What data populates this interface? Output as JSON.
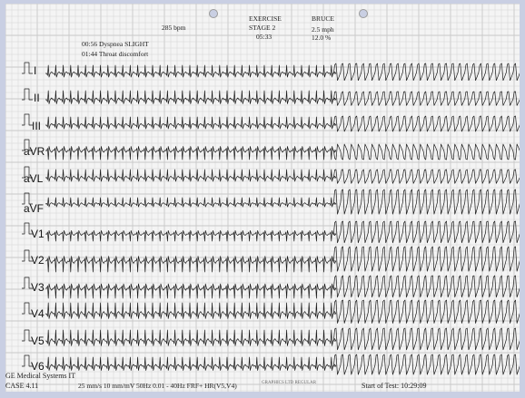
{
  "header": {
    "heart_rate": "285 bpm",
    "protocol_phase": "EXERCISE",
    "stage": "STAGE 2",
    "stage_time": "05:33",
    "protocol_name": "BRUCE",
    "speed": "2.5 mph",
    "grade": "12.0 %",
    "events": [
      "00:56 Dyspnea SLIGHT",
      "01:44 Throat discomfort"
    ]
  },
  "footer": {
    "manufacturer": "GE Medical Systems IT",
    "case_version": "CASE 4.11",
    "settings": "25 mm/s  10 mm/mV  50Hz  0.01 - 40Hz  FRF+  HR(V5,V4)",
    "paper_label": "GRAPHICS LTD   REGULAR",
    "start_of_test": "Start of Test: 10:29:09"
  },
  "colors": {
    "paper": "#f4f4f4",
    "grid": "#c8c8c8",
    "trace": "#1a1a1a",
    "frame": "#c9cfe3"
  },
  "chart_data": {
    "type": "line",
    "title": "",
    "leads": [
      "I",
      "II",
      "III",
      "aVR",
      "aVL",
      "aVF",
      "V1",
      "V2",
      "V3",
      "V4",
      "V5",
      "V6"
    ],
    "heart_rate_bpm": 285,
    "paper_speed_mm_per_s": 25,
    "gain_mm_per_mV": 10,
    "filter": "0.01 - 40Hz",
    "rhythm_segments": [
      "narrow-complex tachycardia",
      "wide-complex tachycardia"
    ],
    "segment_change_fraction": 0.615
  }
}
